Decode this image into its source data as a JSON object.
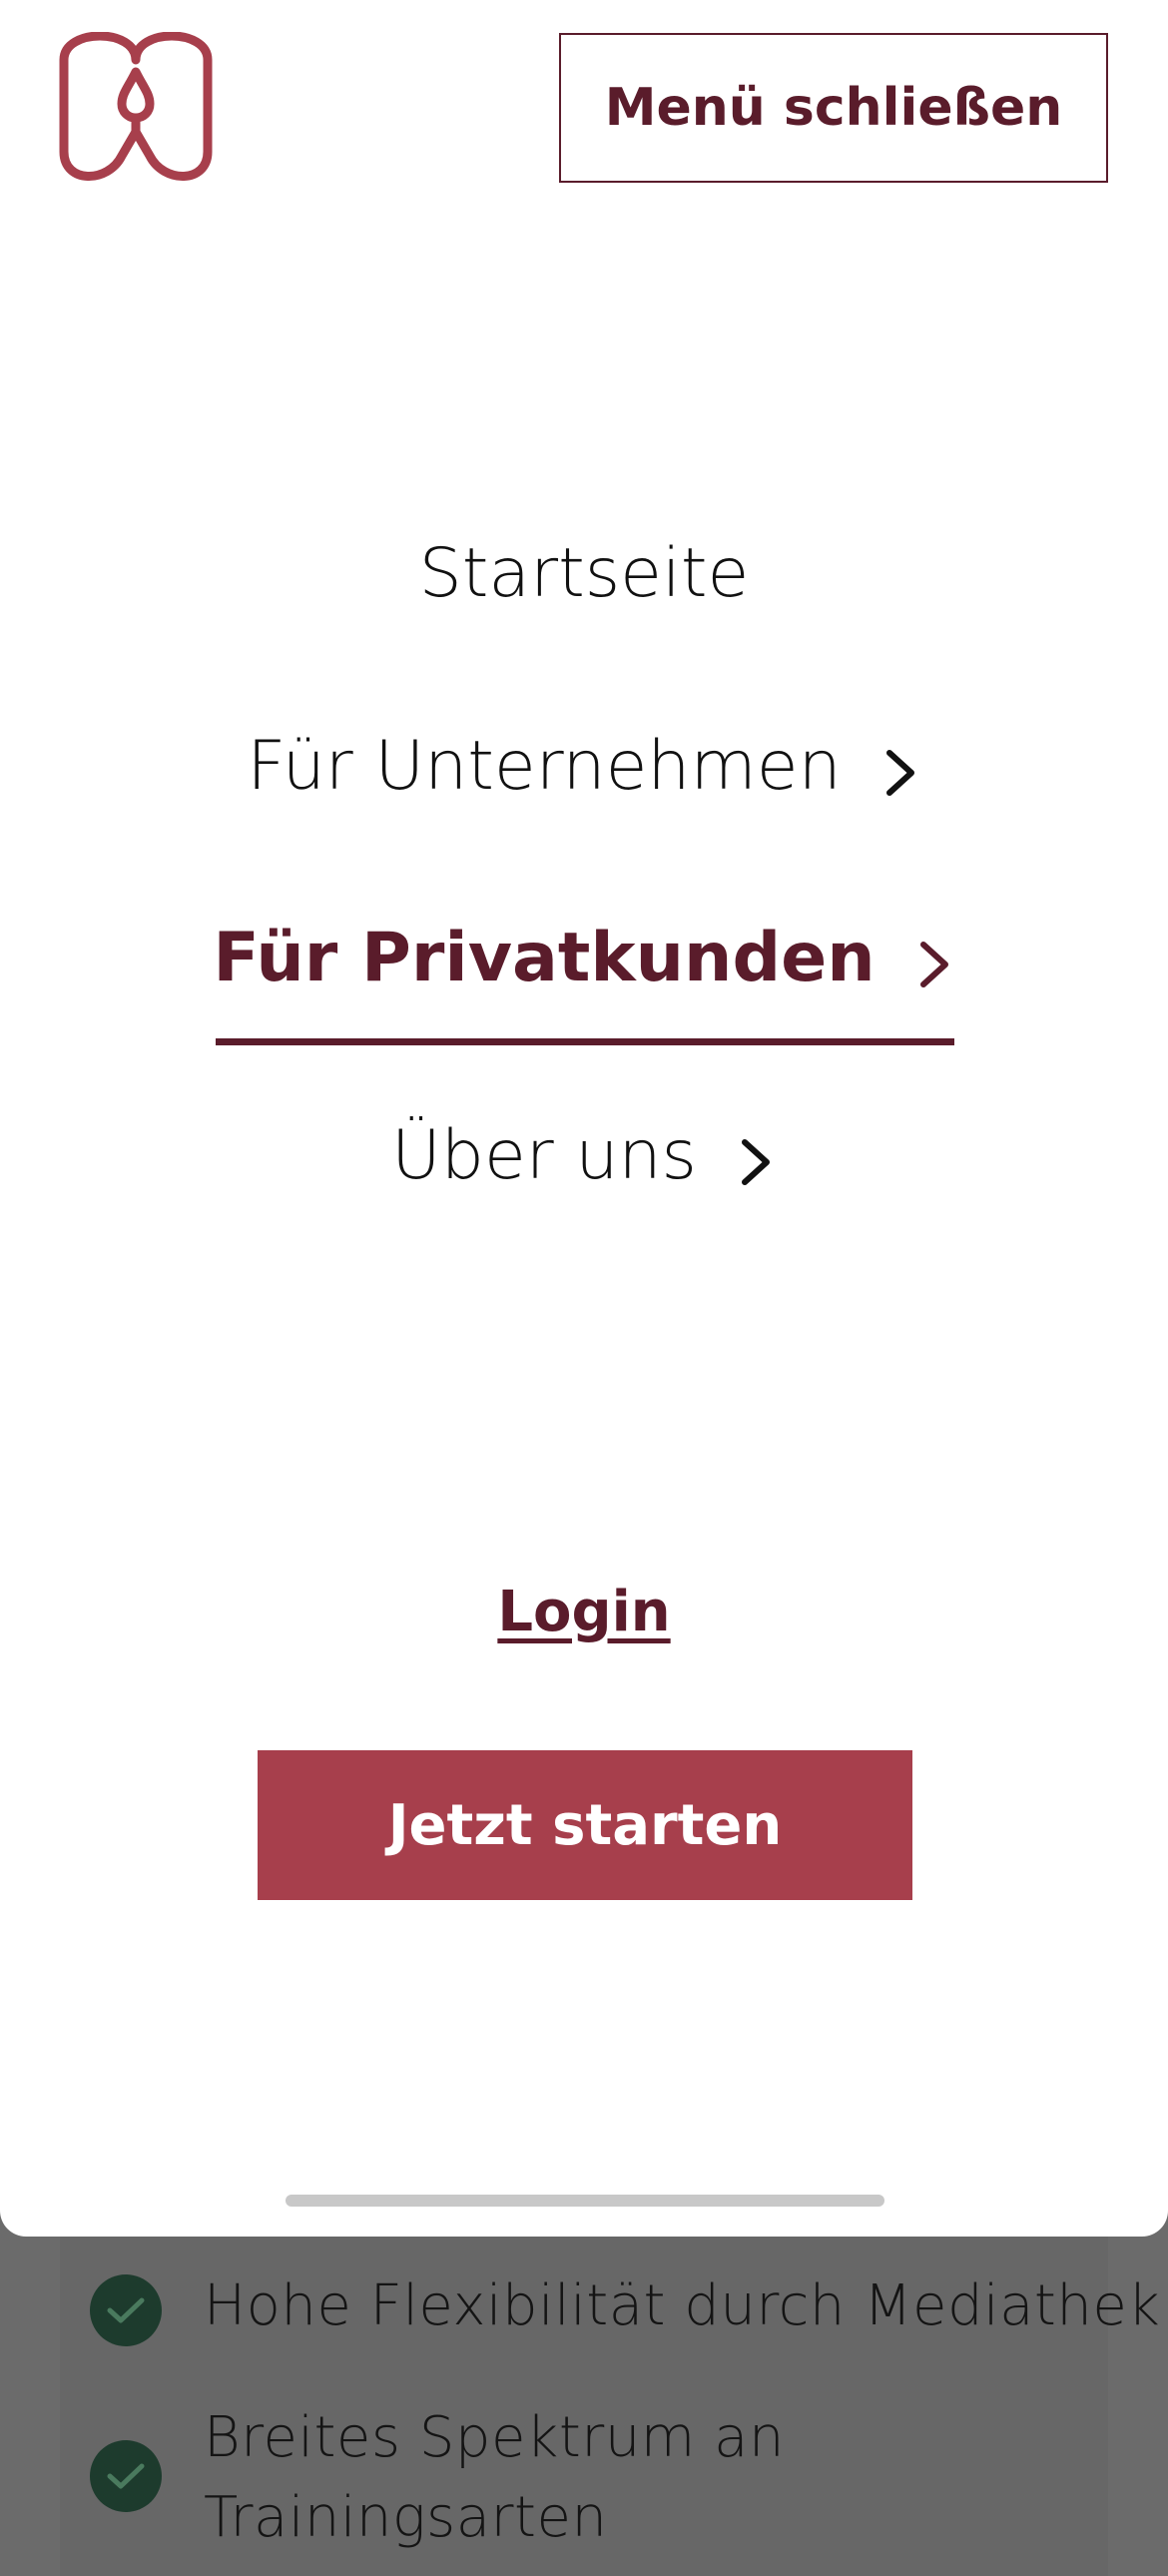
{
  "header": {
    "close_menu_label": "Menü schließen"
  },
  "menu": {
    "items": [
      {
        "label": "Startseite",
        "has_chevron": false,
        "active": false
      },
      {
        "label": "Für Unternehmen",
        "has_chevron": true,
        "active": false
      },
      {
        "label": "Für Privatkunden",
        "has_chevron": true,
        "active": true
      },
      {
        "label": "Über uns",
        "has_chevron": true,
        "active": false
      }
    ],
    "login_label": "Login",
    "cta_label": "Jetzt starten"
  },
  "background": {
    "features": [
      "Hohe Flexibilität durch Mediathek",
      "Breites Spektrum an",
      "Trainingsarten"
    ]
  },
  "colors": {
    "brand_dark": "#5a1c2b",
    "brand_accent": "#a73f4c",
    "check_bg": "#1d3b2d"
  }
}
